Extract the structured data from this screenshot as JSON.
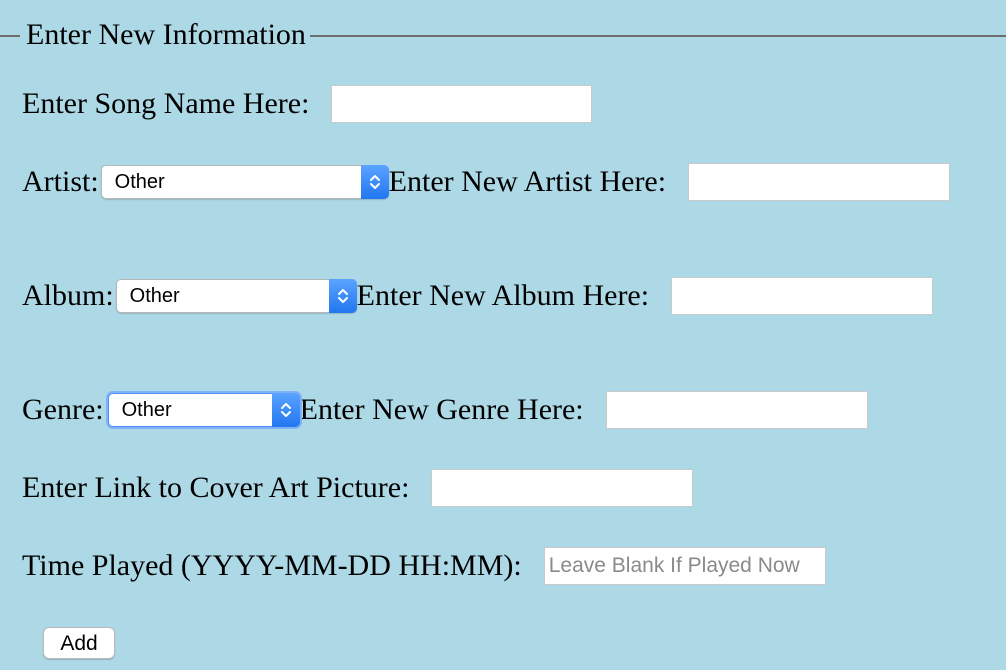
{
  "fieldset": {
    "legend": "Enter New Information"
  },
  "song": {
    "label": "Enter Song Name Here:",
    "value": ""
  },
  "artist": {
    "label": "Artist:",
    "selected": "Other",
    "new_label": "Enter New Artist Here:",
    "new_value": ""
  },
  "album": {
    "label": "Album:",
    "selected": "Other",
    "new_label": "Enter New Album Here:",
    "new_value": ""
  },
  "genre": {
    "label": "Genre:",
    "selected": "Other",
    "new_label": "Enter New Genre Here:",
    "new_value": ""
  },
  "cover": {
    "label": "Enter Link to Cover Art Picture:",
    "value": ""
  },
  "time": {
    "label": "Time Played (YYYY-MM-DD HH:MM):",
    "placeholder": "Leave Blank If Played Now",
    "value": ""
  },
  "add_button": {
    "label": "Add"
  },
  "colors": {
    "background": "#add8e6",
    "select_arrow": "#2b7ef5"
  }
}
